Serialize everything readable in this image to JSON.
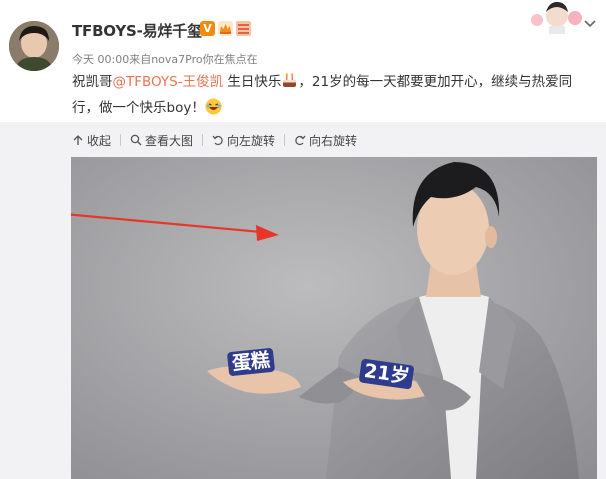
{
  "post": {
    "username": "TFBOYS-易烊千玺",
    "vip_badge": "V",
    "meta": "今天 00:00来自nova7Pro你在焦点在",
    "text_prefix": "祝凯哥",
    "mention": "@TFBOYS-王俊凯",
    "text_mid": " 生日快乐",
    "text_suffix": "，21岁的每一天都要更加开心，继续与热爱同行，做一个快乐boy！"
  },
  "toolbar": {
    "collapse": "收起",
    "view_large": "查看大图",
    "rotate_left": "向左旋转",
    "rotate_right": "向右旋转"
  },
  "photo": {
    "left_label": "蛋糕",
    "right_label": "21岁"
  },
  "colors": {
    "mention": "#eb7350",
    "vip": "#f28b0c",
    "arrow": "#e8352a",
    "meta": "#808080"
  },
  "icons": [
    "chevron-down-icon",
    "vip-icon",
    "crown-icon",
    "member-icon",
    "cake-emoji-icon",
    "laugh-emoji-icon",
    "collapse-icon",
    "zoom-icon",
    "rotate-left-icon",
    "rotate-right-icon",
    "red-arrow-icon"
  ]
}
